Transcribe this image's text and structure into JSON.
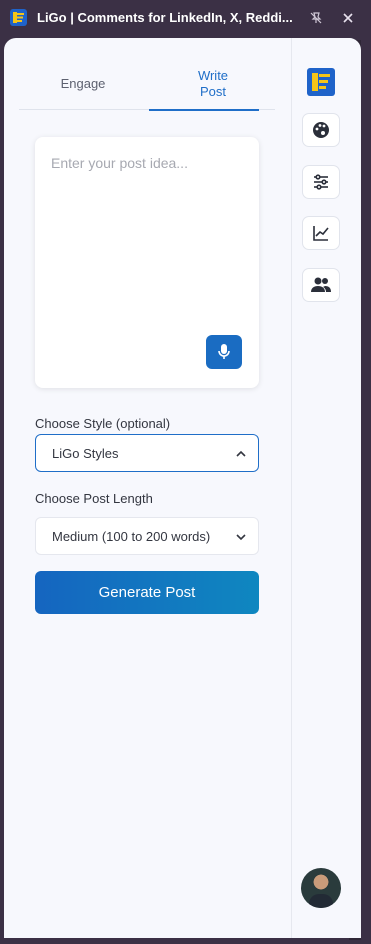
{
  "window": {
    "title": "LiGo | Comments for LinkedIn, X, Reddi...",
    "icons": {
      "app": "ligo-logo-icon",
      "pin": "pin-off-icon",
      "close": "close-icon"
    }
  },
  "tabs": [
    {
      "label": "Engage",
      "active": false
    },
    {
      "label": "Write\nPost",
      "active": true
    }
  ],
  "composer": {
    "placeholder": "Enter your post idea...",
    "value": "",
    "mic_icon": "microphone-icon"
  },
  "style": {
    "label": "Choose Style (optional)",
    "selected": "LiGo Styles",
    "expanded": true
  },
  "length": {
    "label": "Choose Post Length",
    "selected": "Medium (100 to 200 words)"
  },
  "generate_label": "Generate Post",
  "sidebar": {
    "items": [
      {
        "icon": "ligo-logo-icon"
      },
      {
        "icon": "palette-icon"
      },
      {
        "icon": "sliders-icon"
      },
      {
        "icon": "analytics-chart-icon"
      },
      {
        "icon": "users-icon"
      }
    ],
    "avatar": "user-avatar"
  },
  "colors": {
    "accent": "#1f6ec8",
    "titlebar": "#3b3045",
    "panel": "#f7f8fd",
    "button_gradient_start": "#1565c0",
    "button_gradient_end": "#0f87c0"
  }
}
